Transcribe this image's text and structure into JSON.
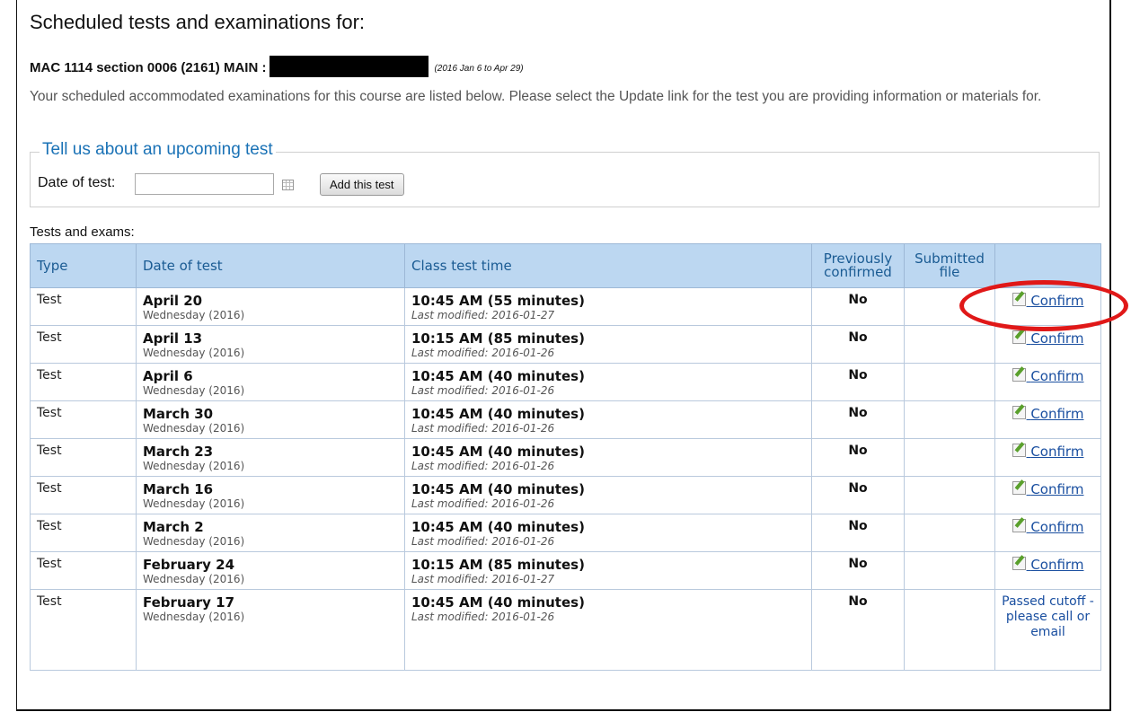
{
  "header": {
    "title": "Scheduled tests and examinations for:",
    "course": "MAC 1114 section 0006 (2161) MAIN :",
    "course_dates": "(2016 Jan 6 to Apr 29)",
    "intro": "Your scheduled accommodated examinations for this course are listed below. Please select the Update link for the test you are providing information or materials for."
  },
  "upcoming": {
    "legend": "Tell us about an upcoming test",
    "date_label": "Date of test:",
    "date_value": "",
    "add_button": "Add this test"
  },
  "tests": {
    "label": "Tests and exams:",
    "columns": [
      "Type",
      "Date of test",
      "Class test time",
      "Previously confirmed",
      "Submitted file",
      ""
    ],
    "rows": [
      {
        "type": "Test",
        "date": "April 20",
        "day": "Wednesday (2016)",
        "time": "10:45 AM (55 minutes)",
        "modified": "Last modified: 2016-01-27",
        "confirmed": "No",
        "file": "",
        "action": "Confirm"
      },
      {
        "type": "Test",
        "date": "April 13",
        "day": "Wednesday (2016)",
        "time": "10:15 AM (85 minutes)",
        "modified": "Last modified: 2016-01-26",
        "confirmed": "No",
        "file": "",
        "action": "Confirm"
      },
      {
        "type": "Test",
        "date": "April 6",
        "day": "Wednesday (2016)",
        "time": "10:45 AM (40 minutes)",
        "modified": "Last modified: 2016-01-26",
        "confirmed": "No",
        "file": "",
        "action": "Confirm"
      },
      {
        "type": "Test",
        "date": "March 30",
        "day": "Wednesday (2016)",
        "time": "10:45 AM (40 minutes)",
        "modified": "Last modified: 2016-01-26",
        "confirmed": "No",
        "file": "",
        "action": "Confirm"
      },
      {
        "type": "Test",
        "date": "March 23",
        "day": "Wednesday (2016)",
        "time": "10:45 AM (40 minutes)",
        "modified": "Last modified: 2016-01-26",
        "confirmed": "No",
        "file": "",
        "action": "Confirm"
      },
      {
        "type": "Test",
        "date": "March 16",
        "day": "Wednesday (2016)",
        "time": "10:45 AM (40 minutes)",
        "modified": "Last modified: 2016-01-26",
        "confirmed": "No",
        "file": "",
        "action": "Confirm"
      },
      {
        "type": "Test",
        "date": "March 2",
        "day": "Wednesday (2016)",
        "time": "10:45 AM (40 minutes)",
        "modified": "Last modified: 2016-01-26",
        "confirmed": "No",
        "file": "",
        "action": "Confirm"
      },
      {
        "type": "Test",
        "date": "February 24",
        "day": "Wednesday (2016)",
        "time": "10:15 AM (85 minutes)",
        "modified": "Last modified: 2016-01-27",
        "confirmed": "No",
        "file": "",
        "action": "Confirm"
      },
      {
        "type": "Test",
        "date": "February 17",
        "day": "Wednesday (2016)",
        "time": "10:45 AM (40 minutes)",
        "modified": "Last modified: 2016-01-26",
        "confirmed": "No",
        "file": "",
        "action": "Passed cutoff - please call or email"
      }
    ]
  },
  "colors": {
    "accent": "#1a72b6",
    "header_bg": "#bcd7f1",
    "highlight": "#e01818",
    "link": "#1a4fa0"
  },
  "icons": {
    "calendar": "calendar-icon",
    "confirm": "edit-icon"
  }
}
